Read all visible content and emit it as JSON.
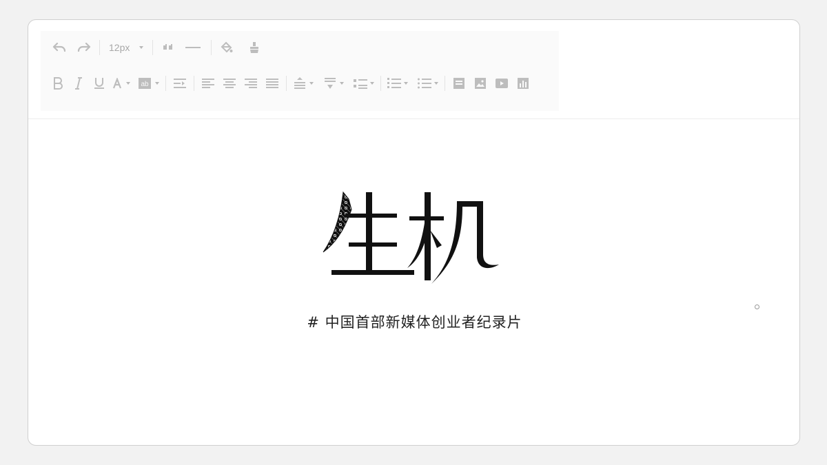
{
  "toolbar": {
    "font_size": "12px",
    "row1": [
      "undo-icon",
      "redo-icon",
      "font-size-select",
      "quote-icon",
      "horizontal-rule-icon",
      "fill-color-icon",
      "clear-format-icon"
    ],
    "row2": [
      "bold-icon",
      "italic-icon",
      "underline-icon",
      "font-color-icon",
      "background-color-icon",
      "indent-icon",
      "align-left-icon",
      "align-center-icon",
      "align-right-icon",
      "align-justify-icon",
      "line-height-icon",
      "paragraph-spacing-icon",
      "letter-spacing-icon",
      "ordered-list-icon",
      "unordered-list-icon",
      "table-icon",
      "image-icon",
      "video-icon",
      "chart-icon"
    ],
    "color": "#b8b8b8"
  },
  "content": {
    "title": "生机",
    "subtitle": "# 中国首部新媒体创业者纪录片"
  },
  "colors": {
    "background": "#f2f2f2",
    "window": "#ffffff",
    "text": "#222222",
    "toolbar_icon": "#b8b8b8"
  }
}
